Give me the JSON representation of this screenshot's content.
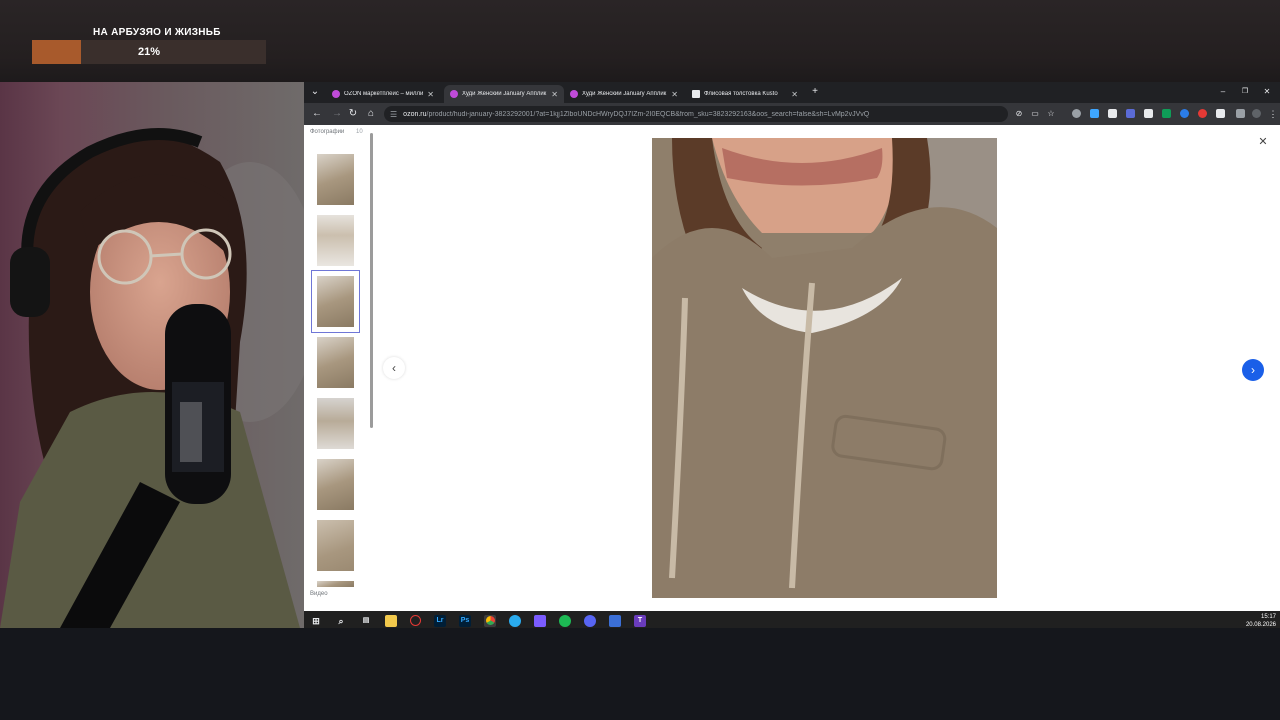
{
  "overlay": {
    "goal_title": "НА АРБУЗЯО И ЖИЗНЬБ",
    "goal_percent_text": "21%",
    "goal_progress": 0.21,
    "accent": "#a85a2c"
  },
  "browser": {
    "tabs": [
      {
        "label": "OZON маркетплейс – миллио",
        "active": false
      },
      {
        "label": "Худи Женский January Апплик",
        "active": true
      },
      {
        "label": "Худи Женский January Апплик",
        "active": false
      },
      {
        "label": "Флисовая толстовка Kusto",
        "active": false
      }
    ],
    "new_tab_icon": "plus-icon",
    "url_domain": "ozon.ru",
    "url_path": "/product/hudi-january-3823292001/?at=1kjj1ZlboUNDcHWryDQJ7IZm-2I0EQCB&from_sku=3823292163&oos_search=false&sh=LvMp2vJVvQ"
  },
  "gallery": {
    "photos_label": "Фотографии",
    "photos_count": "10",
    "video_label": "Видео",
    "selected_thumb": 3,
    "thumbs": [
      "thumb-1",
      "thumb-2",
      "thumb-3",
      "thumb-4",
      "thumb-5",
      "thumb-6",
      "thumb-7",
      "thumb-8"
    ],
    "prev_icon": "chevron-left-icon",
    "next_icon": "arrow-right-icon",
    "close_icon": "close-icon"
  },
  "taskbar": {
    "time": "15:17",
    "date": "20.08.2026",
    "apps": [
      "windows-start",
      "search",
      "task-view",
      "file-explorer",
      "chrome-alt",
      "lightroom",
      "photoshop",
      "chrome",
      "telegram",
      "grid-app",
      "spotify",
      "discord",
      "stats-app",
      "t-app"
    ]
  }
}
